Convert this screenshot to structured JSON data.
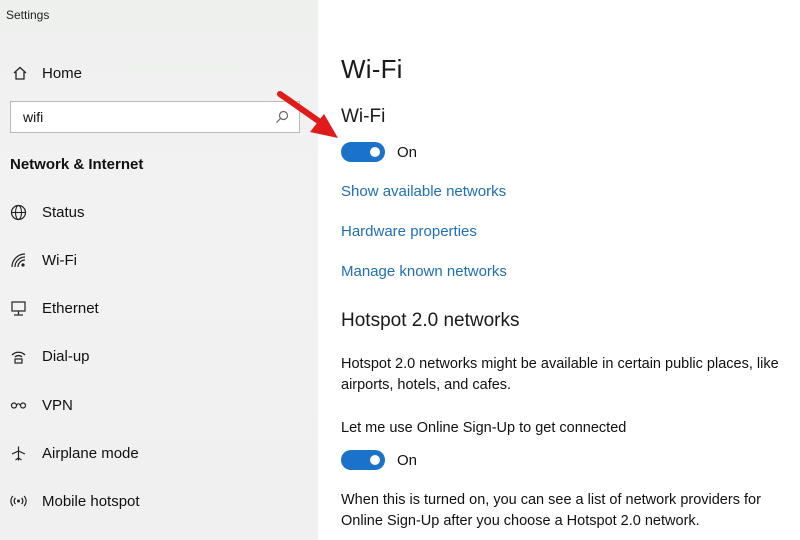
{
  "window": {
    "title": "Settings"
  },
  "sidebar": {
    "home_label": "Home",
    "search": {
      "value": "wifi",
      "placeholder": ""
    },
    "section_heading": "Network & Internet",
    "items": [
      {
        "label": "Status",
        "icon": "globe-icon"
      },
      {
        "label": "Wi-Fi",
        "icon": "wifi-icon"
      },
      {
        "label": "Ethernet",
        "icon": "ethernet-icon"
      },
      {
        "label": "Dial-up",
        "icon": "dialup-icon"
      },
      {
        "label": "VPN",
        "icon": "vpn-icon"
      },
      {
        "label": "Airplane mode",
        "icon": "airplane-icon"
      },
      {
        "label": "Mobile hotspot",
        "icon": "hotspot-icon"
      }
    ]
  },
  "main": {
    "title": "Wi-Fi",
    "wifi_heading": "Wi-Fi",
    "wifi_toggle": {
      "state_label": "On",
      "on": true
    },
    "links": [
      "Show available networks",
      "Hardware properties",
      "Manage known networks"
    ],
    "hotspot_heading": "Hotspot 2.0 networks",
    "hotspot_description": "Hotspot 2.0 networks might be available in certain public places, like airports, hotels, and cafes.",
    "signup_label": "Let me use Online Sign-Up to get connected",
    "signup_toggle": {
      "state_label": "On",
      "on": true
    },
    "signup_description": "When this is turned on, you can see a list of network providers for Online Sign-Up after you choose a Hotspot 2.0 network."
  },
  "colors": {
    "accent": "#1a73c9",
    "link": "#1f6fb5",
    "annotation_arrow": "#e01b1b"
  }
}
